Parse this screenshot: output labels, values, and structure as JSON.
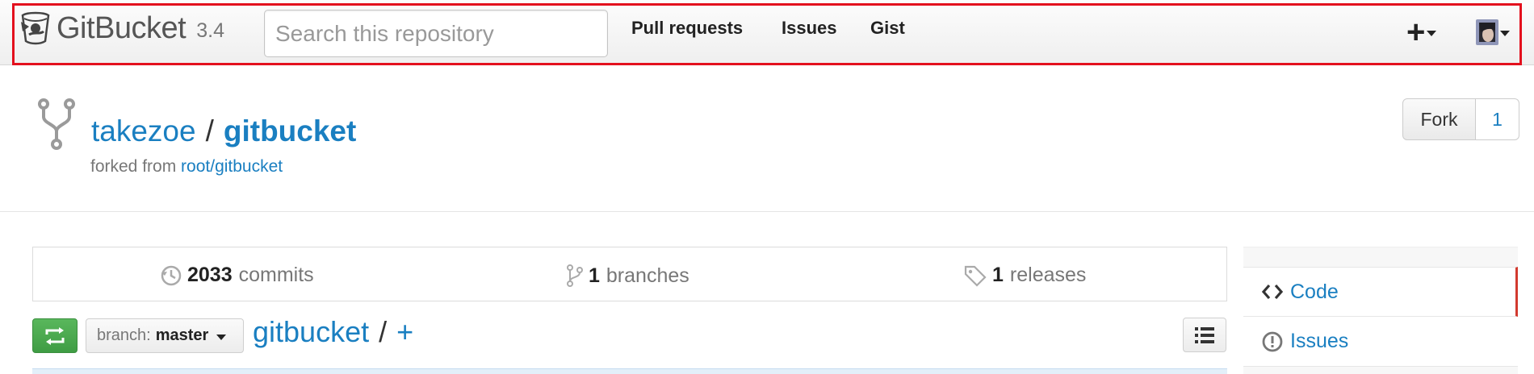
{
  "navbar": {
    "brand_name": "GitBucket",
    "version": "3.4",
    "search_placeholder": "Search this repository",
    "links": [
      "Pull requests",
      "Issues",
      "Gist"
    ],
    "plus_label": "+"
  },
  "repo": {
    "owner": "takezoe",
    "separator": "/",
    "name": "gitbucket",
    "forked_prefix": "forked from",
    "forked_from": "root/gitbucket",
    "fork_label": "Fork",
    "fork_count": "1"
  },
  "stats": {
    "commits_count": "2033",
    "commits_label": "commits",
    "branches_count": "1",
    "branches_label": "branches",
    "releases_count": "1",
    "releases_label": "releases"
  },
  "branch_row": {
    "branch_prefix": "branch:",
    "branch_name": "master",
    "path_repo": "gitbucket",
    "path_separator": "/",
    "path_add": "+"
  },
  "side_menu": {
    "items": [
      {
        "label": "Code",
        "icon": "code-icon",
        "active": true
      },
      {
        "label": "Issues",
        "icon": "issue-opened-icon",
        "active": false
      }
    ]
  },
  "colors": {
    "link": "#1a7fc1",
    "highlight_border": "#e3101d",
    "active_indicator": "#d23a2f",
    "compare_button": "#4caf50"
  }
}
